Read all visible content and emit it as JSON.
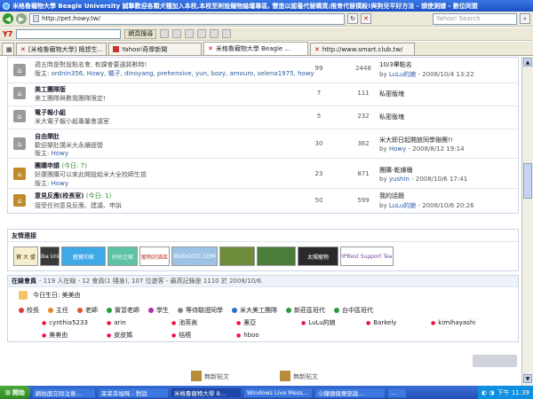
{
  "window": {
    "title": "米格魯寵物大學 Beagle University 誠摯歡迎各類犬種加入本校,本校至附設寵物論壇專區, 營造以認養代替購買;推育代替撲殺!與狗兒平好方法 - 請使測譜 - 數位同盟"
  },
  "address": {
    "url": "http://pet.howy.tw/",
    "search_placeholder": "Yahoo! Search"
  },
  "toolbar": {
    "logo": "Y7",
    "search_button": "網頁搜尋",
    "extra_icons": [
      "pencil-icon",
      "box-icon",
      "wrench-icon",
      "cart-icon",
      "car-icon",
      "mail-icon"
    ]
  },
  "tabs": [
    {
      "label": "[米格魯寵物大學] 概想生..."
    },
    {
      "label": "Yahoo!奇摩新聞"
    },
    {
      "label": "米格魯寵物大學 Beagle ..."
    },
    {
      "label": "http://www.smart.club.tw/"
    }
  ],
  "forums": [
    {
      "name": "",
      "desc": "週五時是對設點名會, 有課會要選將數時!",
      "mods_label": "版主:",
      "mods": "ordnin356, Howy, 橘子, dinoyang, prehensive, yun, bozy, amouro, selena1975, howy",
      "topics": "99",
      "posts": "2448",
      "last_title": "10/3畢點名",
      "last_by_prefix": "by",
      "last_user": "LuLu的娘",
      "last_time": "- 2008/10/4 13:22",
      "today": "",
      "new": false
    },
    {
      "name": "美工團隊版",
      "desc": "美工團隊與數我團隊限定!",
      "mods_label": "",
      "mods": "",
      "topics": "7",
      "posts": "111",
      "last_title": "私密版塊",
      "last_by_prefix": "",
      "last_user": "",
      "last_time": "",
      "today": "",
      "new": false
    },
    {
      "name": "電子報小組",
      "desc": "米大電子報小組專屬會議室",
      "mods_label": "",
      "mods": "",
      "topics": "5",
      "posts": "232",
      "last_title": "私密版塊",
      "last_by_prefix": "",
      "last_user": "",
      "last_time": "",
      "today": "",
      "new": false
    },
    {
      "name": "自由樂肚",
      "desc": "歡迎樂肚講米大永續經營",
      "mods_label": "版主:",
      "mods": "Howy",
      "topics": "30",
      "posts": "362",
      "last_title": "米大即日起開放同學揪團!!",
      "last_by_prefix": "by",
      "last_user": "Howy",
      "last_time": "- 2008/8/12 19:14",
      "today": "",
      "new": false
    },
    {
      "name": "團購申請",
      "desc": "好康團購可以來此開設給米大全校師生撿",
      "mods_label": "版主:",
      "mods": "Howy",
      "topics": "23",
      "posts": "871",
      "last_title": "團購-乾燥桶",
      "last_by_prefix": "by",
      "last_user": "yushin",
      "last_time": "- 2008/10/6 17:41",
      "today": "(今日: 7)",
      "new": true
    },
    {
      "name": "意見反應(校長室)",
      "desc": "接受任何意見反應、建議、申訴",
      "mods_label": "版主:",
      "mods": "Howy",
      "topics": "50",
      "posts": "599",
      "last_title": "我的話題",
      "last_by_prefix": "by",
      "last_user": "LuLu的娘",
      "last_time": "- 2008/10/6 20:26",
      "today": "(今日: 1)",
      "new": true
    }
  ],
  "links_box": {
    "title": "友情連接",
    "banners": [
      {
        "text": "寶 大 盟",
        "bg": "#f7f0d0",
        "fg": "#553300"
      },
      {
        "text": "Shiba Union",
        "bg": "#3a3a3a",
        "fg": "#ffffff"
      },
      {
        "text": "豬寶的家",
        "bg": "#3fa9e8",
        "fg": "#ffffff"
      },
      {
        "text": "好好之家",
        "bg": "#5cc3a5",
        "fg": "#ffffff"
      },
      {
        "text": "寵物討論區",
        "bg": "#ffffff",
        "fg": "#c23a2a"
      },
      {
        "text": "WUDOGTC.COM",
        "bg": "#9cc3e6",
        "fg": "#ffffff"
      },
      {
        "text": "",
        "bg": "#6e8c3a",
        "fg": "#ffffff"
      },
      {
        "text": "",
        "bg": "#4a7c3a",
        "fg": "#ffffff"
      },
      {
        "text": "太陽寵物",
        "bg": "#2a2a2a",
        "fg": "#ffffff"
      },
      {
        "text": "PHPBest Support Team",
        "bg": "#ffffff",
        "fg": "#7a4aa0"
      }
    ]
  },
  "online_box": {
    "title": "在線會員",
    "summary": "- 119 人在線 - 12 會員(1 隱身), 107 位遊客 - 最高記錄是 1110 於 2008/10/6.",
    "birthday_label": "今日生日: 美美由",
    "groups": [
      {
        "label": "校長",
        "color": "#e23b3b"
      },
      {
        "label": "主任",
        "color": "#e08b2a"
      },
      {
        "label": "老師",
        "color": "#e05a2a"
      },
      {
        "label": "實習老師",
        "color": "#2a9a3a"
      },
      {
        "label": "學生",
        "color": "#b02ab0"
      },
      {
        "label": "等待驗證同學",
        "color": "#888888"
      },
      {
        "label": "米大美工團隊",
        "color": "#2a6ad0"
      },
      {
        "label": "新莊區班代",
        "color": "#2a9a3a"
      },
      {
        "label": "台中區班代",
        "color": "#2a9a3a"
      }
    ],
    "members": [
      [
        "cynthia5233",
        "arin",
        "池英嵩",
        "憲亞",
        "LuLu的娘",
        "Barkely",
        "kimihayashi"
      ],
      [
        "美美由",
        "皮皮媽",
        "桔梧",
        "hboo"
      ]
    ]
  },
  "bottom": {
    "items": [
      "無新貼文",
      "無新貼文"
    ]
  },
  "taskbar": {
    "start": "開始",
    "tasks": [
      "網拍面交除注意...",
      "呆呆幸福嗎 - 對話",
      "米格魯寵物大學 B...",
      "Windows Live Mess...",
      "小鐘頭俱樂部論...",
      "..."
    ],
    "clock": "下午 11:39"
  }
}
